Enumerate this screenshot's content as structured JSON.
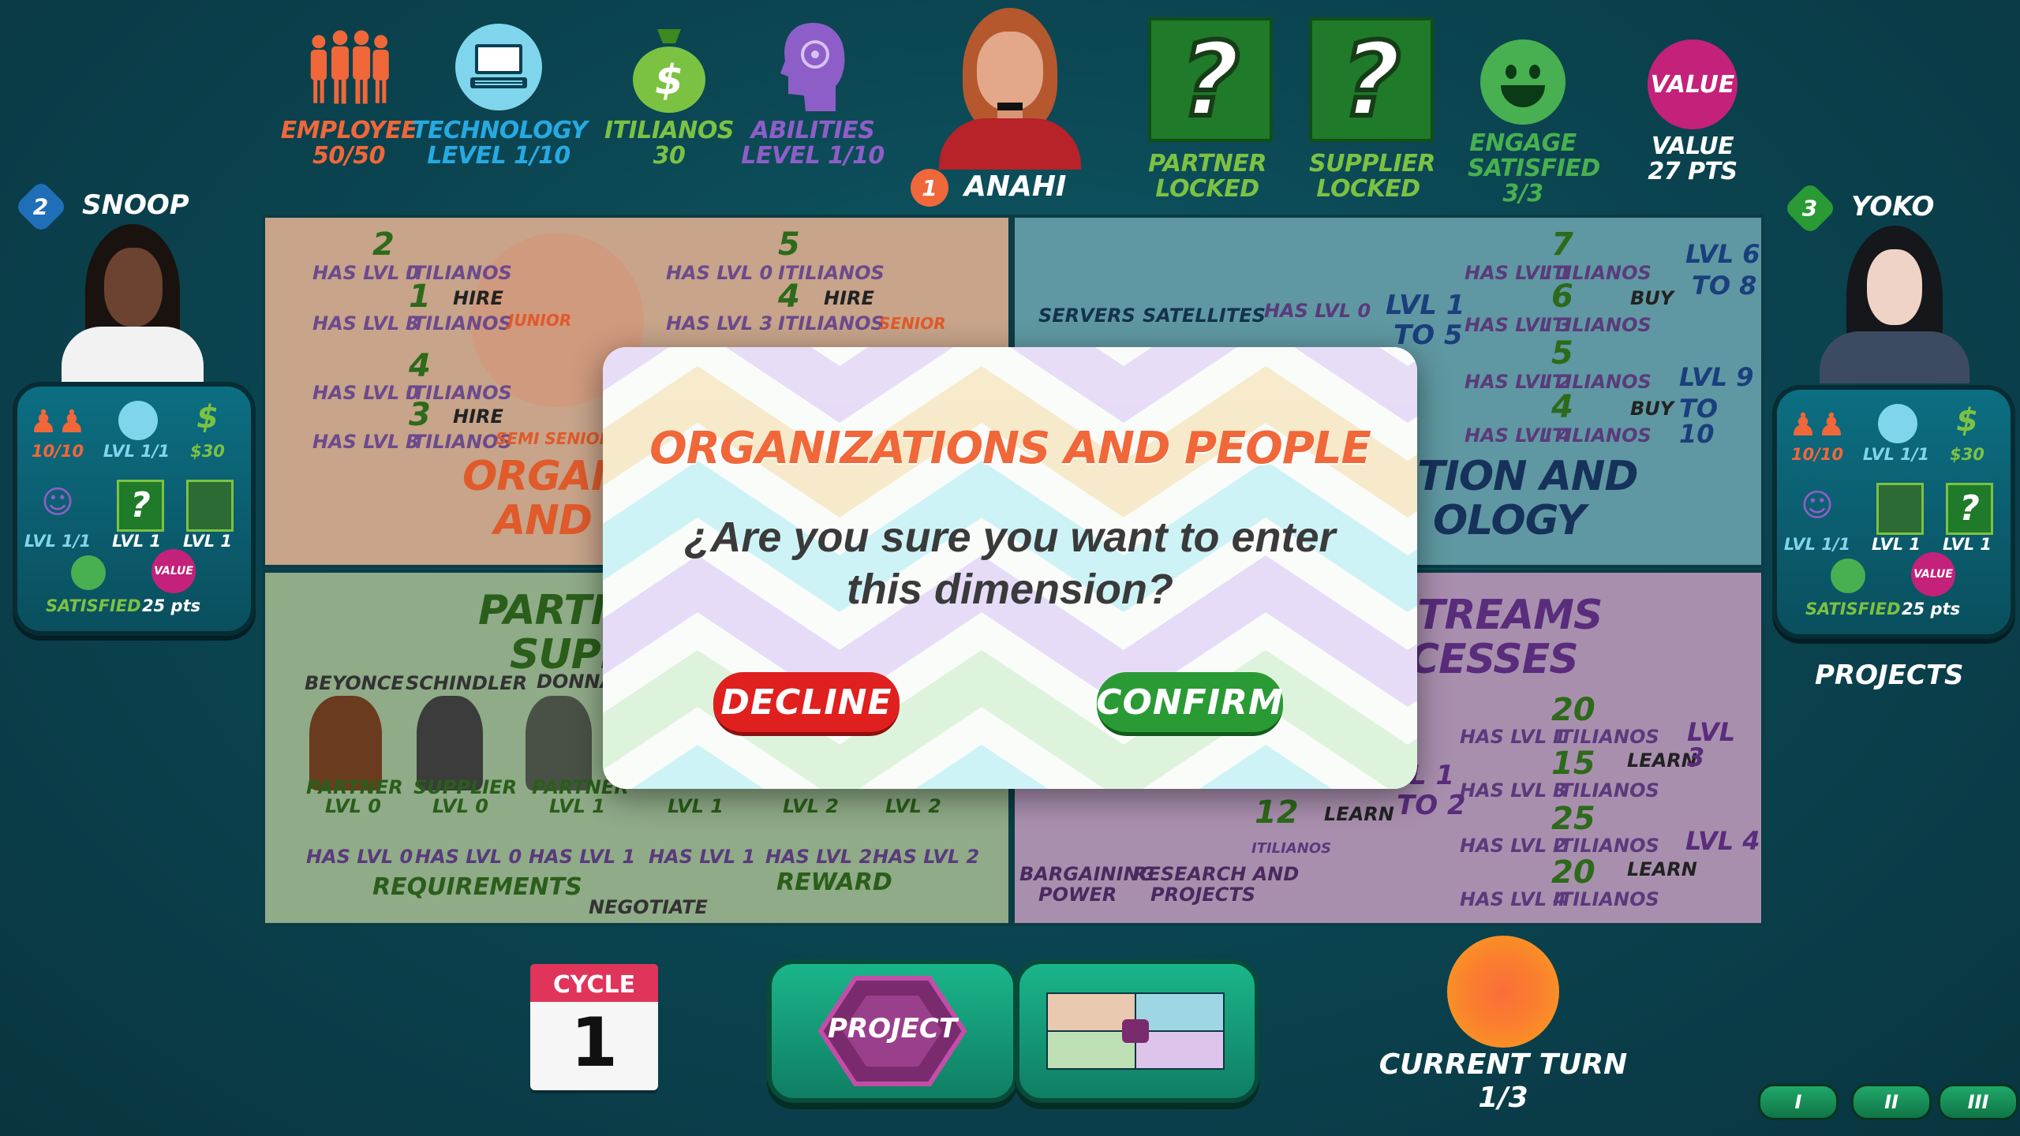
{
  "top_stats": {
    "employee": {
      "label": "EMPLOYEE",
      "value": "50/50",
      "color": "#f0673a",
      "icon": "employees-icon"
    },
    "technology": {
      "label": "TECHNOLOGY",
      "value": "LEVEL  1/10",
      "color": "#27a9e1",
      "icon": "computer-icon"
    },
    "itilianos": {
      "label": "ITILIANOS",
      "value": "30",
      "color": "#7cc242",
      "icon": "money-bag-icon"
    },
    "abilities": {
      "label": "ABILITIES",
      "value": "LEVEL  1/10",
      "color": "#8e5ec8",
      "icon": "brain-head-icon"
    },
    "player": {
      "number": "1",
      "name": "ANAHI"
    },
    "partner": {
      "label": "PARTNER",
      "state": "LOCKED",
      "color": "#7cc242",
      "icon": "question-mark-icon"
    },
    "supplier": {
      "label": "SUPPLIER",
      "state": "LOCKED",
      "color": "#7cc242",
      "icon": "question-mark-icon"
    },
    "engage": {
      "label": "ENGAGE",
      "state": "SATISFIED",
      "value": "3/3",
      "color": "#48b050",
      "icon": "smiley-icon"
    },
    "value": {
      "badge": "VALUE",
      "label": "VALUE",
      "pts": "27 PTS",
      "color": "#c3217a"
    }
  },
  "left_player": {
    "number": "2",
    "name": "SNOOP",
    "stats": {
      "employees": "10/10",
      "tech": "LVL 1/1",
      "money": "$30",
      "abilities": "LVL 1/1",
      "partner": "LVL 1",
      "supplier": "LVL 1",
      "satisfied": "SATISFIED",
      "value_badge": "VALUE",
      "pts": "25 pts"
    }
  },
  "right_player": {
    "number": "3",
    "name": "YOKO",
    "stats": {
      "employees": "10/10",
      "tech": "LVL 1/1",
      "money": "$30",
      "abilities": "LVL 1/1",
      "partner": "LVL 1",
      "supplier": "LVL 1",
      "satisfied": "SATISFIED",
      "value_badge": "VALUE",
      "pts": "25 pts"
    },
    "projects_label": "PROJECTS"
  },
  "board": {
    "org": {
      "title1": "ORGANI",
      "title2": "AND PI",
      "junior": {
        "c1": "2",
        "c2": "1",
        "has0": "HAS LVL 0",
        "has3": "HAS LVL 3",
        "itil": "ITILIANOS",
        "hire": "HIRE",
        "role": "JUNIOR"
      },
      "senior": {
        "c1": "5",
        "c2": "4",
        "has0": "HAS LVL 0",
        "has3": "HAS LVL 3",
        "itil": "ITILIANOS",
        "hire": "HIRE",
        "role": "SENIOR"
      },
      "semi": {
        "c1": "4",
        "c2": "3",
        "has0": "HAS LVL 0",
        "has3": "HAS LVL 3",
        "itil": "ITILIANOS",
        "hire": "HIRE",
        "role": "SEMI SENIOR"
      }
    },
    "tech": {
      "title1": "TION AND",
      "title2": "OLOGY",
      "servers": "SERVERS",
      "satellites": "SATELLITES",
      "has0": "HAS LVL 0",
      "buy": "BUY",
      "lvl15a": "LVL 1",
      "lvl15b": "TO 5",
      "r1": {
        "has": "HAS LVL 1",
        "c": "7"
      },
      "r2": {
        "has": "HAS LVL 3",
        "c": "6"
      },
      "r3": {
        "has": "HAS LVL 2",
        "c": "5"
      },
      "r4": {
        "has": "HAS LVL 4",
        "c": "4"
      },
      "itil": "ITILIANOS",
      "lvl68a": "LVL 6",
      "lvl68b": "TO 8",
      "lvl910a": "LVL 9",
      "lvl910b": "TO 10"
    },
    "partners": {
      "title1": "PARTNI",
      "title2": "SUPP",
      "names": [
        "BEYONCE",
        "SCHINDLER",
        "DONNA"
      ],
      "tags": [
        "PARTNER",
        "SUPPLIER",
        "PARTNER"
      ],
      "tag_lvls": [
        "LVL 0",
        "LVL 0",
        "LVL 1"
      ],
      "req_has": [
        "HAS LVL 0",
        "HAS LVL 0",
        "HAS LVL 1",
        "HAS LVL 1",
        "HAS LVL 2",
        "HAS LVL 2"
      ],
      "lvls2": [
        "LVL 1",
        "LVL 2",
        "LVL 2"
      ],
      "requirements": "REQUIREMENTS",
      "negotiate": "NEGOTIATE",
      "reward": "REWARD"
    },
    "streams": {
      "title1": "TREAMS",
      "title2": "CESSES",
      "bargaining1": "BARGAINING",
      "bargaining2": "POWER",
      "research1": "RESEARCH AND",
      "research2": "PROJECTS",
      "c12": "12",
      "learn": "LEARN",
      "itil": "ITILIANOS",
      "lvl12a": "L 1",
      "lvl12b": "TO 2",
      "r1": {
        "has": "HAS LVL 1",
        "c": "20"
      },
      "r2": {
        "has": "HAS LVL 3",
        "c": "15"
      },
      "r3": {
        "has": "HAS LVL 2",
        "c": "25"
      },
      "r4": {
        "has": "HAS LVL 4",
        "c": "20"
      },
      "lvl3": "LVL 3",
      "lvl4": "LVL 4"
    }
  },
  "modal": {
    "title": "ORGANIZATIONS AND PEOPLE",
    "question_line1": "¿Are you sure you want to enter",
    "question_line2": "this dimension?",
    "decline": "DECLINE",
    "confirm": "CONFIRM",
    "title_color": "#f0673a",
    "decline_color": "#e0201f",
    "confirm_color": "#2a9a35"
  },
  "bottom": {
    "cycle_label": "CYCLE",
    "cycle_value": "1",
    "project_label": "PROJECT",
    "turn_label": "CURRENT TURN",
    "turn_value": "1/3",
    "pills": [
      "I",
      "II",
      "III"
    ]
  }
}
